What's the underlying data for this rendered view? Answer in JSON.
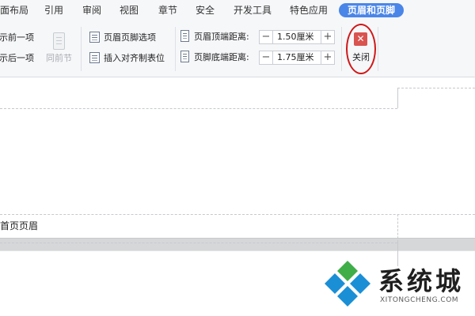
{
  "menu": {
    "tabs": [
      {
        "label": "页面布局"
      },
      {
        "label": "引用"
      },
      {
        "label": "审阅"
      },
      {
        "label": "视图"
      },
      {
        "label": "章节"
      },
      {
        "label": "安全"
      },
      {
        "label": "开发工具"
      },
      {
        "label": "特色应用"
      },
      {
        "label": "页眉和页脚"
      }
    ],
    "active_tab": "页眉和页脚"
  },
  "ribbon": {
    "nav": {
      "show_prev": "显示前一项",
      "show_next": "显示后一项",
      "same_as_previous": "同前节"
    },
    "options": {
      "hf_options": "页眉页脚选项",
      "insert_align_tab": "插入对齐制表位"
    },
    "position": {
      "header_top_label": "页眉顶端距离:",
      "header_top_value": "1.50厘米",
      "footer_bottom_label": "页脚底端距离:",
      "footer_bottom_value": "1.75厘米",
      "minus": "−",
      "plus": "+"
    },
    "close": {
      "label": "关闭",
      "glyph": "✕"
    }
  },
  "document": {
    "header_label": "首页页眉"
  },
  "watermark": {
    "title": "系统城",
    "subtitle": "XITONGCHENG.COM"
  },
  "colors": {
    "active_tab": "#4a86e8",
    "close_button": "#d9534f",
    "annotation_ring": "#d01818",
    "logo_blue": "#1a8fd6",
    "logo_green": "#3fae49"
  }
}
